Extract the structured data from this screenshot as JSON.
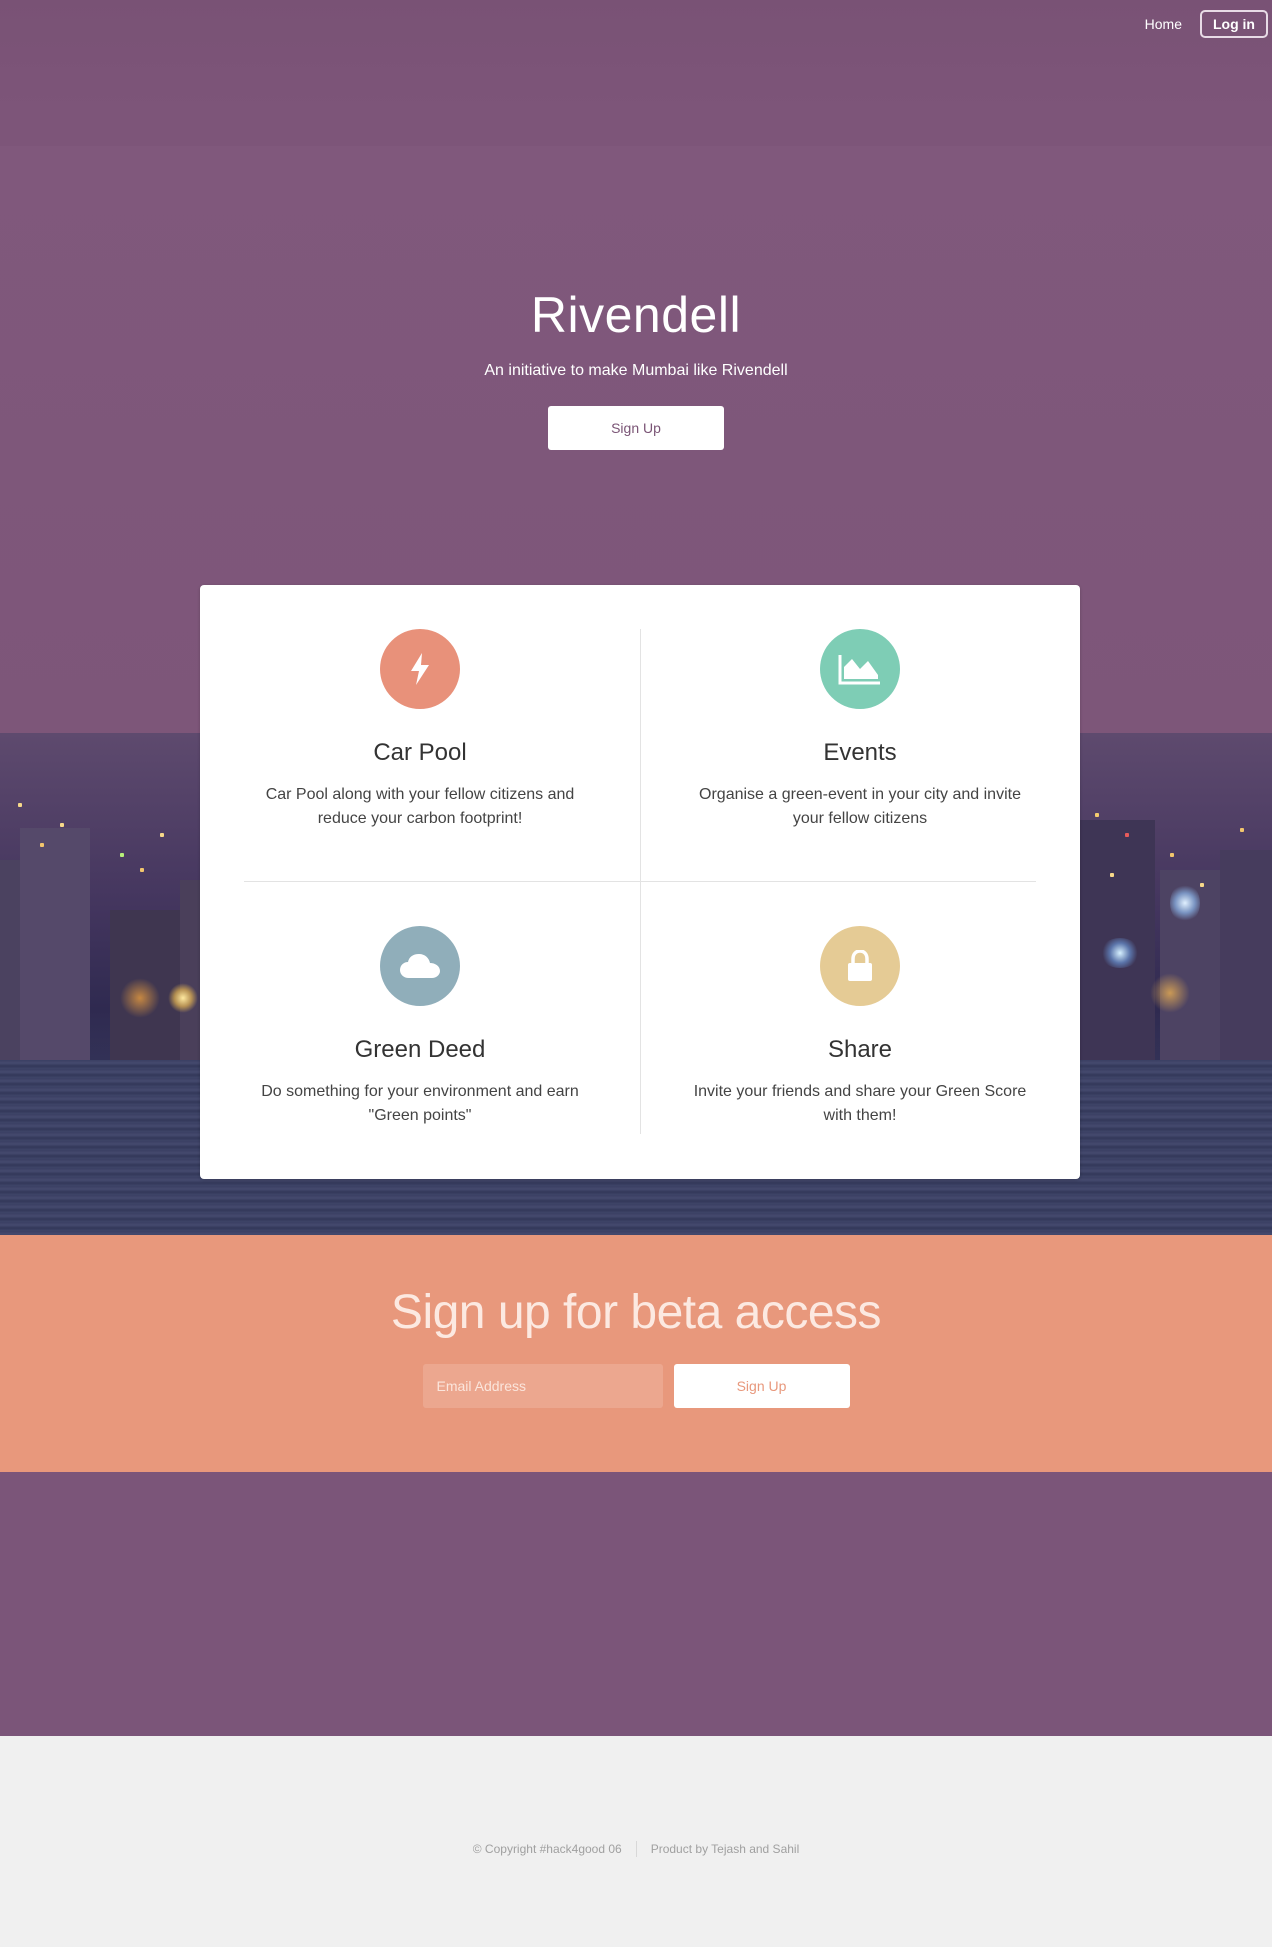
{
  "nav": {
    "home": "Home",
    "login": "Log in"
  },
  "hero": {
    "title": "Rivendell",
    "subtitle": "An initiative to make Mumbai like Rivendell",
    "cta": "Sign Up"
  },
  "features": [
    {
      "title": "Car Pool",
      "description": "Car Pool along with your fellow citizens and reduce your carbon footprint!",
      "icon": "bolt-icon",
      "color": "#e8917a"
    },
    {
      "title": "Events",
      "description": "Organise a green-event in your city and invite your fellow citizens",
      "icon": "area-chart-icon",
      "color": "#7ecdb5"
    },
    {
      "title": "Green Deed",
      "description": "Do something for your environment and earn \"Green points\"",
      "icon": "cloud-icon",
      "color": "#90aeba"
    },
    {
      "title": "Share",
      "description": "Invite your friends and share your Green Score with them!",
      "icon": "lock-icon",
      "color": "#e5cb95"
    }
  ],
  "beta": {
    "title": "Sign up for beta access",
    "email_placeholder": "Email Address",
    "button": "Sign Up"
  },
  "footer": {
    "copyright": "© Copyright #hack4good 06",
    "credit": "Product by Tejash and Sahil"
  },
  "colors": {
    "hero_bg": "#7d5679",
    "beta_bg": "#e8987c",
    "footer_bg": "#f0f0f0"
  }
}
